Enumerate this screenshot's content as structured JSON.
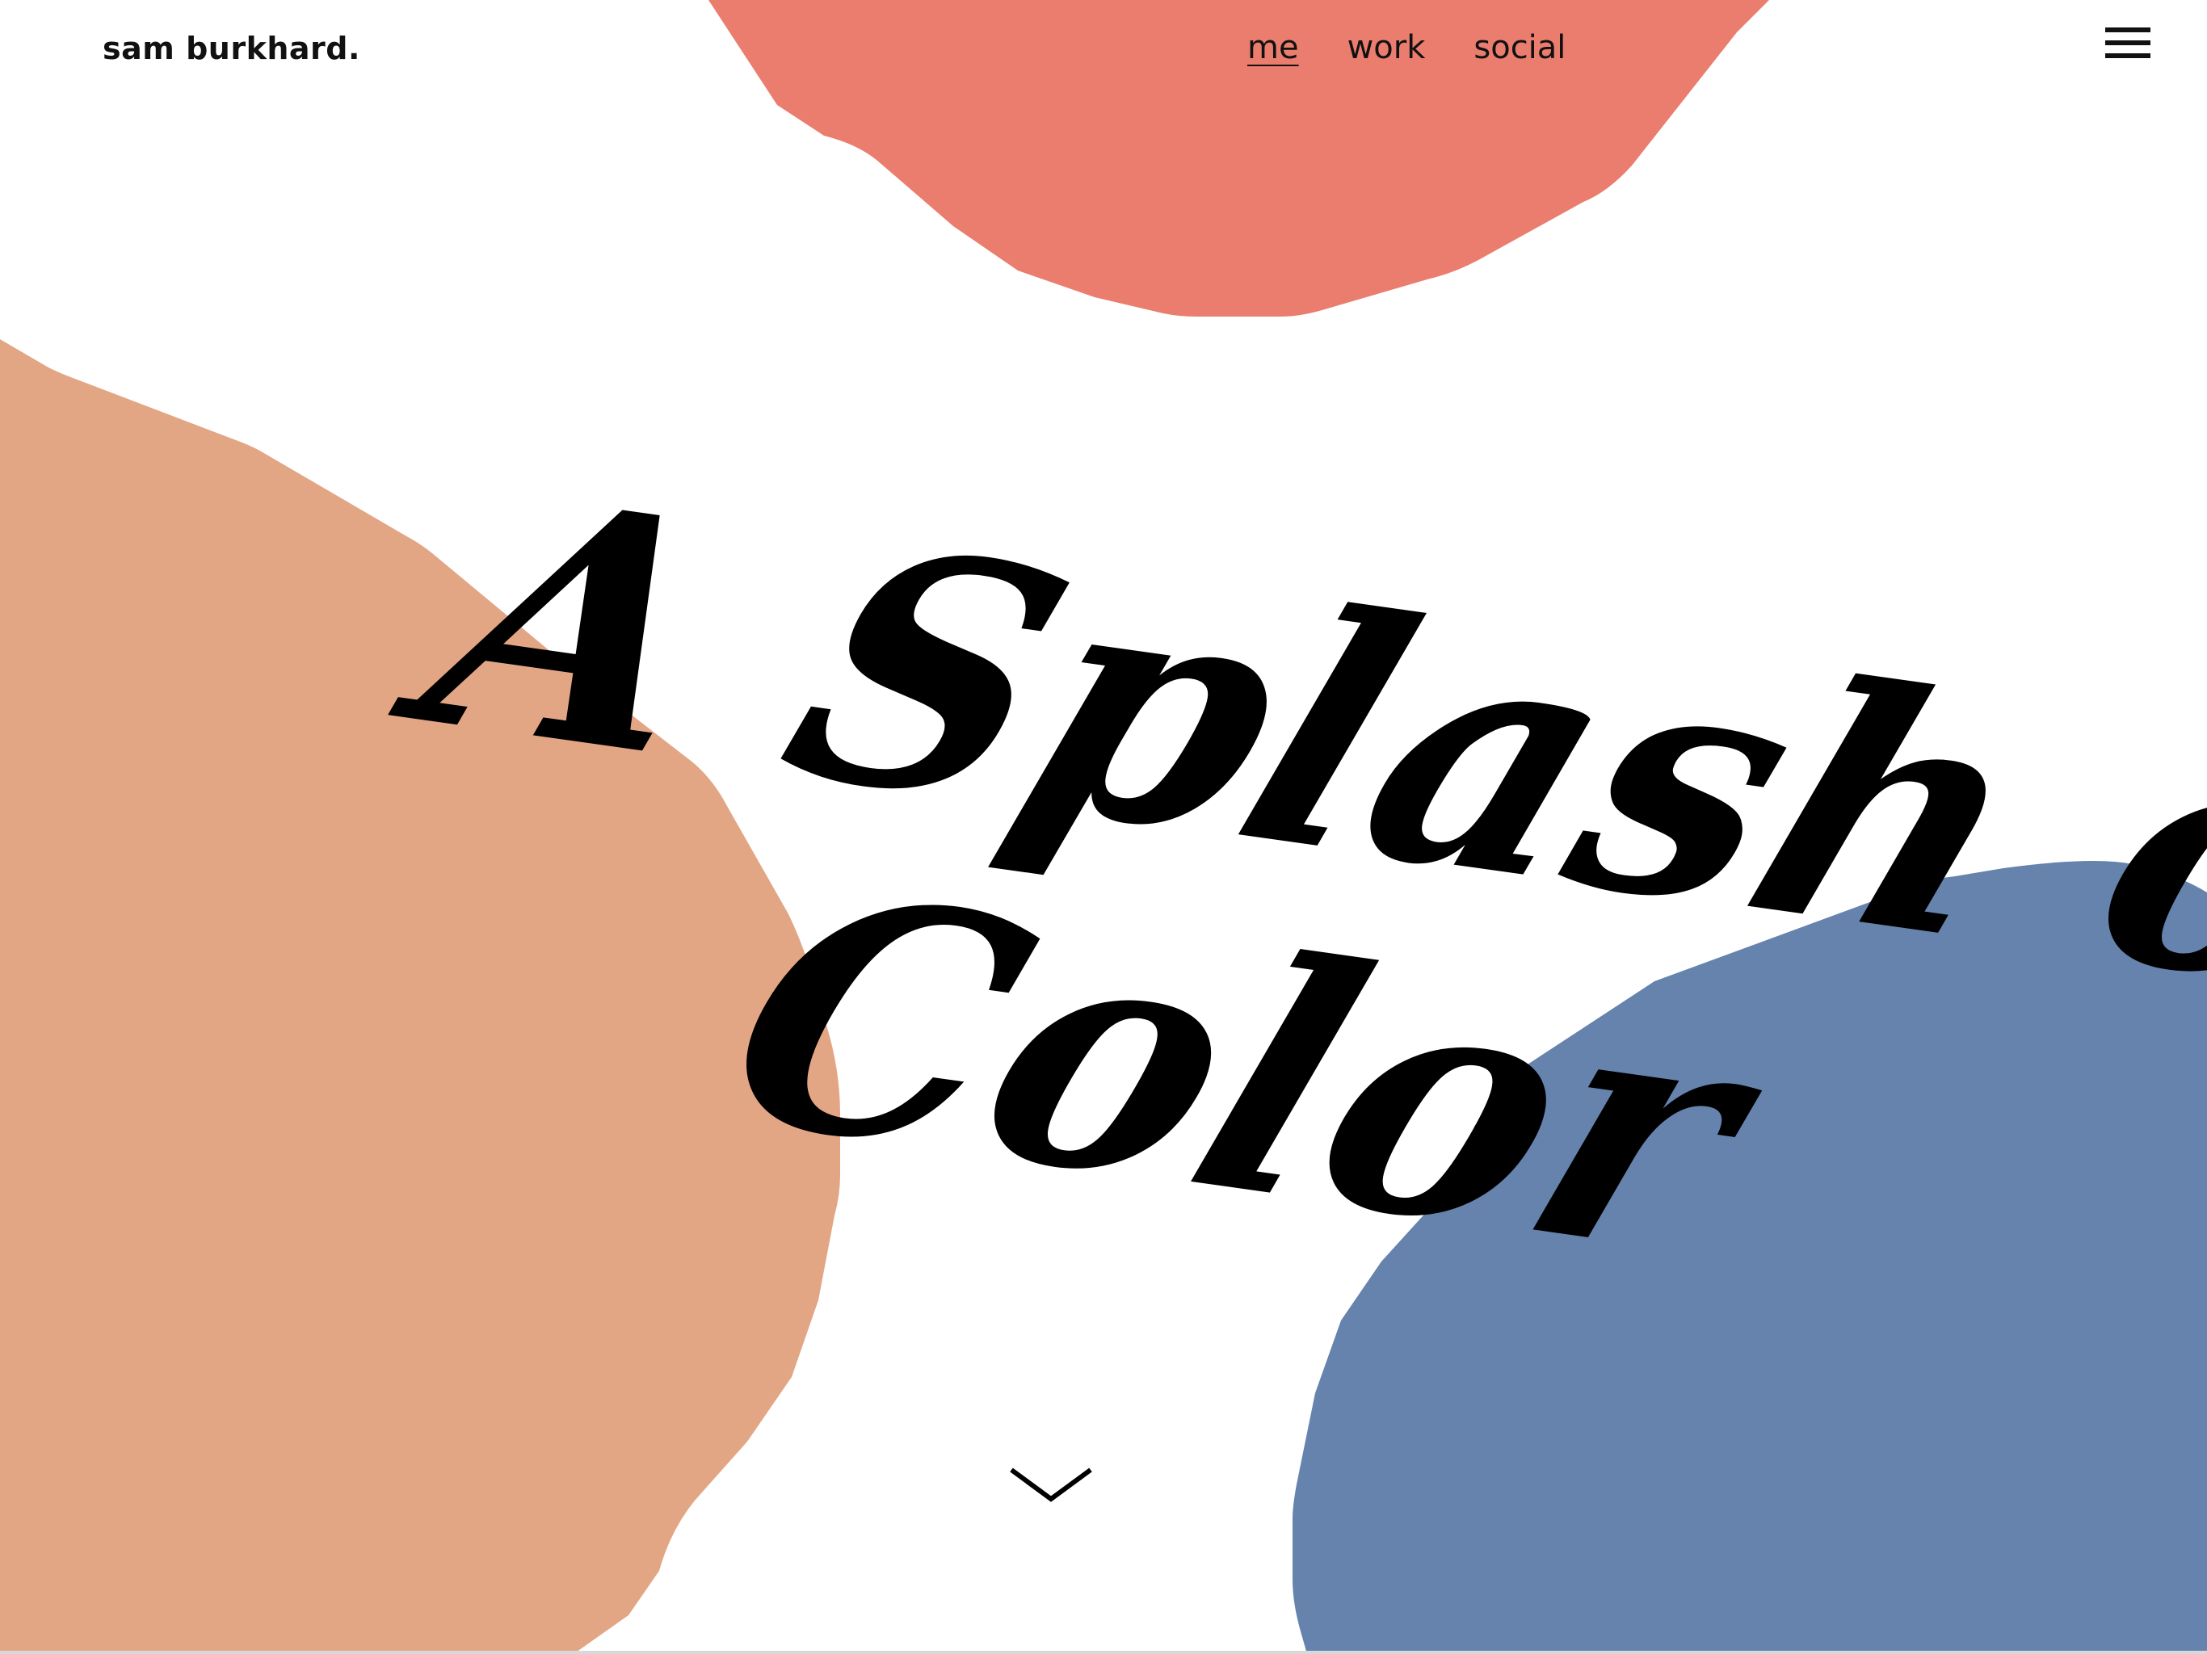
{
  "header": {
    "brand": "sam burkhard.",
    "nav": [
      {
        "label": "me",
        "active": true
      },
      {
        "label": "work",
        "active": false
      },
      {
        "label": "social",
        "active": false
      }
    ],
    "menu_icon": "hamburger-menu-icon"
  },
  "hero": {
    "line1": "A Splash of",
    "line2": "Color",
    "scroll_icon": "chevron-down-icon"
  },
  "colors": {
    "coral": "#EA7D6E",
    "peach": "#E2A685",
    "slate_blue": "#6583AD",
    "text": "#111111",
    "background": "#FFFFFF"
  }
}
